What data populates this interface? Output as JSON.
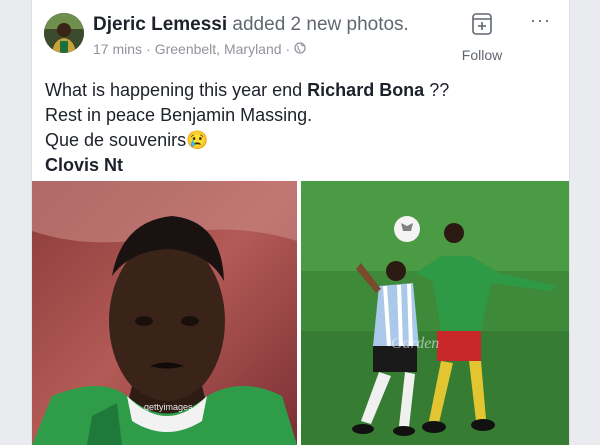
{
  "post": {
    "author": "Djeric Lemessi",
    "action": "added 2 new photos.",
    "time": "17 mins",
    "separator": "·",
    "location": "Greenbelt, Maryland",
    "privacy_icon": "globe-icon",
    "follow_label": "Follow",
    "more_label": "···",
    "text_line1_prefix": "What is happening this year end ",
    "text_line1_bold": "Richard Bona",
    "text_line1_suffix": " ??",
    "text_line2": "Rest in peace Benjamin Massing.",
    "text_line3": "Que de souvenirs",
    "text_line3_emoji": "😢",
    "text_line4": "Clovis Nt"
  },
  "photos": {
    "photo1_watermark": "gettyimages",
    "photo2_watermark": "Garden"
  },
  "colors": {
    "text": "#1d2129",
    "meta": "#90949c",
    "background": "#e9ebee",
    "pitch_green": "#3f8a3a",
    "jersey_green": "#2e9a45",
    "shorts_red": "#c8282a"
  }
}
